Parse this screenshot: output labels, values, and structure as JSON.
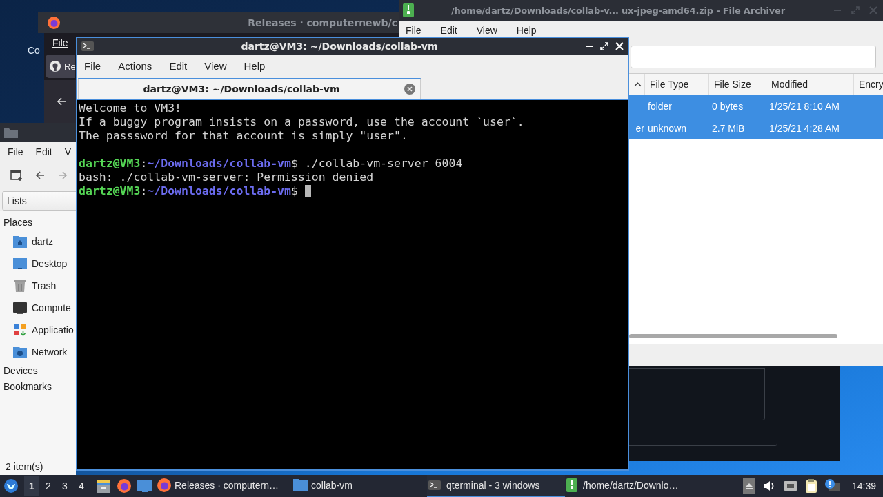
{
  "desktop": {
    "icon_label": "Co"
  },
  "browser": {
    "title": "Releases · computernewb/c",
    "menu": [
      "File"
    ],
    "tab_label": "Re"
  },
  "file_manager": {
    "menu": [
      "File",
      "Edit",
      "V"
    ],
    "view_mode": "Lists",
    "sections": [
      {
        "label": "Places",
        "items": [
          {
            "label": "dartz",
            "kind": "home"
          },
          {
            "label": "Desktop",
            "kind": "desktop"
          },
          {
            "label": "Trash",
            "kind": "trash"
          },
          {
            "label": "Compute",
            "kind": "computer"
          },
          {
            "label": "Applicatio",
            "kind": "apps"
          },
          {
            "label": "Network",
            "kind": "network"
          }
        ]
      },
      {
        "label": "Devices"
      },
      {
        "label": "Bookmarks"
      }
    ],
    "status": "2 item(s)"
  },
  "terminal": {
    "title": "dartz@VM3: ~/Downloads/collab-vm",
    "menu": [
      "File",
      "Actions",
      "Edit",
      "View",
      "Help"
    ],
    "tabs": [
      {
        "label": "dartz@VM3: ~/Downloads/collab-vm",
        "selected": true
      }
    ],
    "lines": [
      {
        "kind": "output",
        "segments": [
          {
            "kind": "text",
            "text": "Welcome to VM3!"
          }
        ]
      },
      {
        "kind": "output",
        "segments": [
          {
            "kind": "text",
            "text": "If a buggy program insists on a password, use the account `user`."
          }
        ]
      },
      {
        "kind": "output",
        "segments": [
          {
            "kind": "text",
            "text": "The passsword for that account is simply \"user\"."
          }
        ]
      },
      {
        "kind": "blank"
      },
      {
        "kind": "output",
        "segments": [
          {
            "kind": "user",
            "text": "dartz@VM3"
          },
          {
            "kind": "text",
            "text": ":"
          },
          {
            "kind": "path",
            "text": "~/Downloads/collab-vm"
          },
          {
            "kind": "text",
            "text": "$ ./collab-vm-server 6004"
          }
        ]
      },
      {
        "kind": "output",
        "segments": [
          {
            "kind": "text",
            "text": "bash: ./collab-vm-server: Permission denied"
          }
        ]
      },
      {
        "kind": "output",
        "segments": [
          {
            "kind": "user",
            "text": "dartz@VM3"
          },
          {
            "kind": "text",
            "text": ":"
          },
          {
            "kind": "path",
            "text": "~/Downloads/collab-vm"
          },
          {
            "kind": "text",
            "text": "$ "
          }
        ]
      }
    ],
    "cursor": true
  },
  "archiver": {
    "title": "/home/dartz/Downloads/collab-v... ux-jpeg-amd64.zip - File Archiver",
    "menu": [
      "File",
      "Edit",
      "View",
      "Help"
    ],
    "columns": [
      "File Type",
      "File Size",
      "Modified",
      "Encry"
    ],
    "rows": [
      {
        "selected": true,
        "cells": [
          "folder",
          "0 bytes",
          "1/25/21 8:10 AM"
        ]
      },
      {
        "selected": true,
        "name_tail": "er",
        "cells": [
          "unknown",
          "2.7 MiB",
          "1/25/21 4:28 AM"
        ]
      }
    ]
  },
  "taskbar": {
    "workspaces": [
      {
        "label": "1",
        "selected": true
      },
      {
        "label": "2",
        "selected": false
      },
      {
        "label": "3",
        "selected": false
      },
      {
        "label": "4",
        "selected": false
      }
    ],
    "tasks": [
      {
        "label": "Releases · computern…",
        "kind": "firefox",
        "selected": false
      },
      {
        "label": "collab-vm",
        "kind": "folder",
        "selected": false
      },
      {
        "label": "qterminal - 3 windows",
        "kind": "terminal",
        "selected": true
      },
      {
        "label": "/home/dartz/Downlo…",
        "kind": "archive",
        "selected": false
      }
    ],
    "clock": "14:39"
  }
}
